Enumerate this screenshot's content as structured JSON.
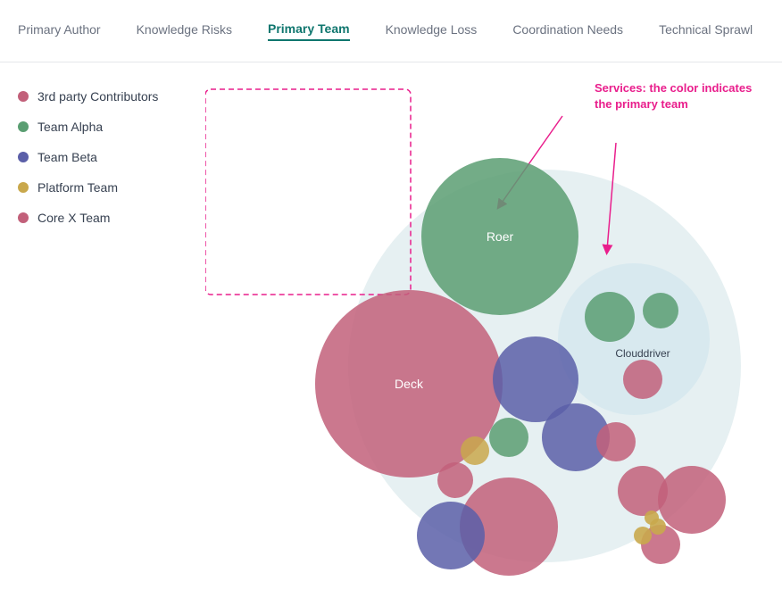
{
  "nav": {
    "items": [
      {
        "label": "Primary Author",
        "active": false
      },
      {
        "label": "Knowledge Risks",
        "active": false
      },
      {
        "label": "Primary Team",
        "active": true
      },
      {
        "label": "Knowledge Loss",
        "active": false
      },
      {
        "label": "Coordination Needs",
        "active": false
      },
      {
        "label": "Technical Sprawl",
        "active": false
      }
    ]
  },
  "legend": {
    "items": [
      {
        "label": "3rd party Contributors",
        "color": "#c2607a"
      },
      {
        "label": "Team Alpha",
        "color": "#5a9e72"
      },
      {
        "label": "Team Beta",
        "color": "#5b5fa8"
      },
      {
        "label": "Platform Team",
        "color": "#c9a84c"
      },
      {
        "label": "Core X Team",
        "color": "#c2607a"
      }
    ]
  },
  "annotation": {
    "text": "Services: the color indicates the primary team"
  },
  "bubbles": {
    "roer_label": "Roer",
    "deck_label": "Deck",
    "clouddriver_label": "Clouddriver"
  }
}
